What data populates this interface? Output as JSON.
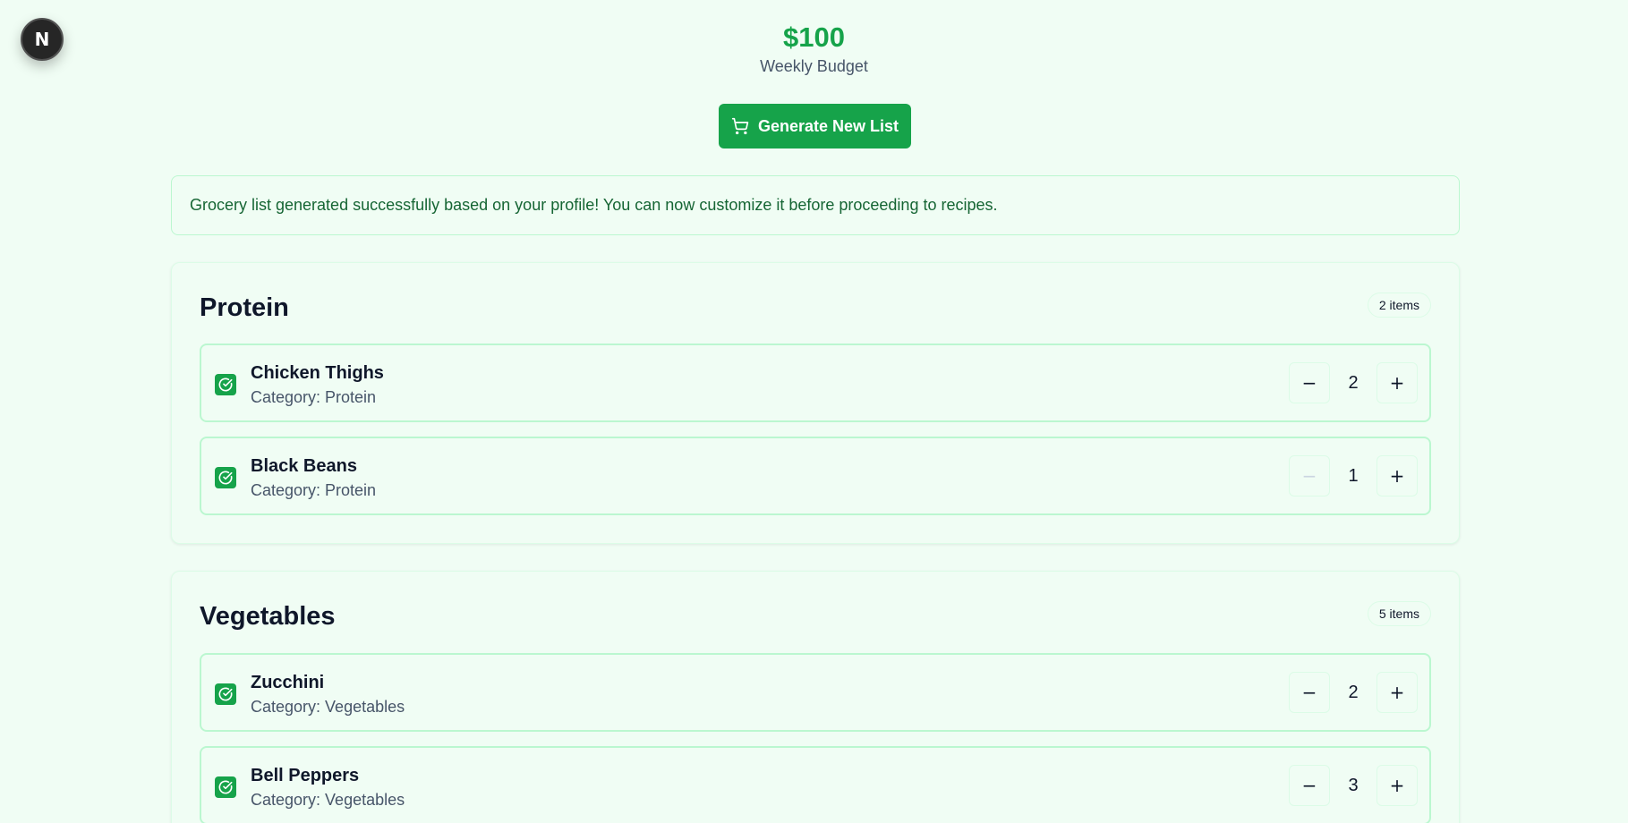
{
  "app": {
    "logo_letter": "N"
  },
  "header": {
    "budget_amount": "$100",
    "budget_label": "Weekly Budget",
    "generate_label": "Generate New List"
  },
  "alert": {
    "message": "Grocery list generated successfully based on your profile! You can now customize it before proceeding to recipes."
  },
  "colors": {
    "accent": "#16a34a",
    "background": "#f0fdf4",
    "border": "#bbf7d0"
  },
  "categories": [
    {
      "title": "Protein",
      "count_label": "2 items",
      "items": [
        {
          "name": "Chicken Thighs",
          "category": "Category: Protein",
          "quantity": "2",
          "checked": true,
          "minus_symbol": "−",
          "plus_symbol": "+"
        },
        {
          "name": "Black Beans",
          "category": "Category: Protein",
          "quantity": "1",
          "checked": true,
          "minus_symbol": "−",
          "plus_symbol": "+"
        }
      ]
    },
    {
      "title": "Vegetables",
      "count_label": "5 items",
      "items": [
        {
          "name": "Zucchini",
          "category": "Category: Vegetables",
          "quantity": "2",
          "checked": true,
          "minus_symbol": "−",
          "plus_symbol": "+"
        },
        {
          "name": "Bell Peppers",
          "category": "Category: Vegetables",
          "quantity": "3",
          "checked": true,
          "minus_symbol": "−",
          "plus_symbol": "+"
        }
      ]
    }
  ]
}
